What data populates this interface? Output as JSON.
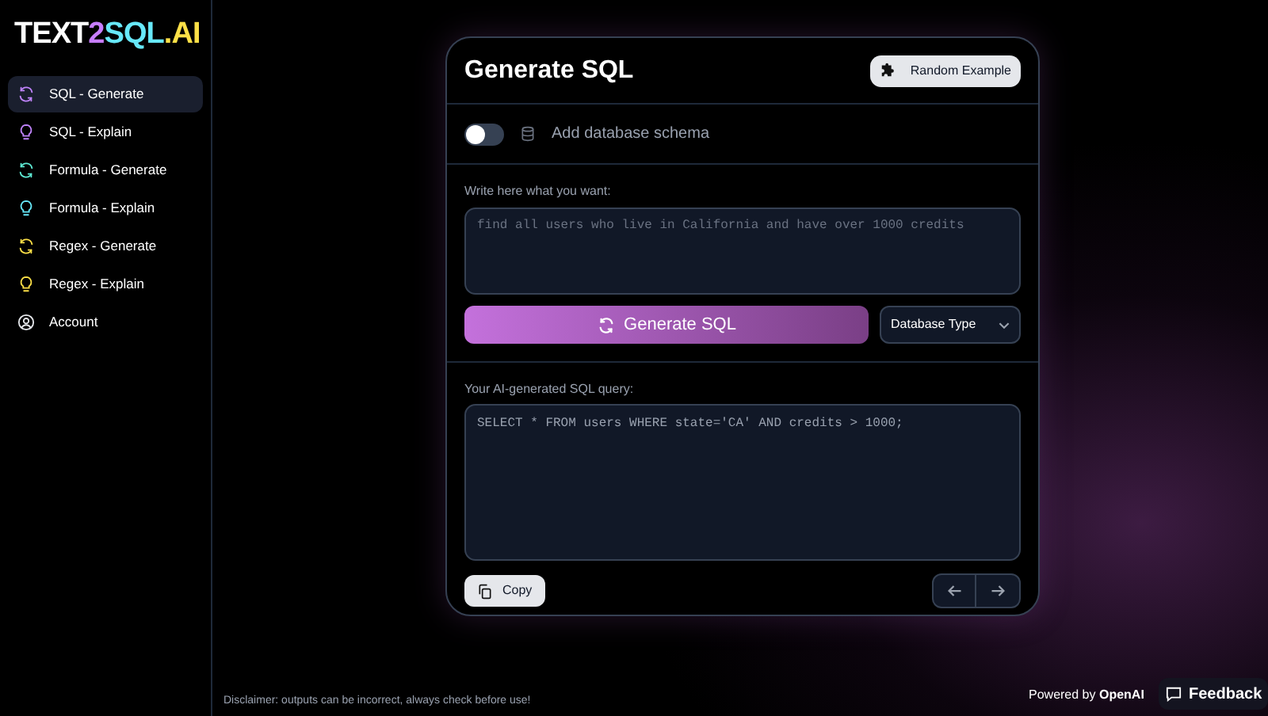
{
  "logo": [
    {
      "text": "TEXT",
      "color": "#ffffff"
    },
    {
      "text": "2",
      "color": "#c77dff"
    },
    {
      "text": "SQL",
      "color": "#67e8f9"
    },
    {
      "text": ".AI",
      "color": "#fde047"
    }
  ],
  "sidebar": {
    "items": [
      {
        "label": "SQL - Generate",
        "kind": "generate",
        "color": "#c084fc",
        "selected": true
      },
      {
        "label": "SQL - Explain",
        "kind": "explain",
        "color": "#c084fc",
        "selected": false
      },
      {
        "label": "Formula - Generate",
        "kind": "generate",
        "color": "#5eead4",
        "selected": false
      },
      {
        "label": "Formula - Explain",
        "kind": "explain",
        "color": "#67e8f9",
        "selected": false
      },
      {
        "label": "Regex - Generate",
        "kind": "generate",
        "color": "#fde047",
        "selected": false
      },
      {
        "label": "Regex - Explain",
        "kind": "explain",
        "color": "#fde047",
        "selected": false
      },
      {
        "label": "Account",
        "kind": "account",
        "color": "#e5e7eb",
        "selected": false
      }
    ]
  },
  "card": {
    "title": "Generate SQL",
    "random_button": "Random Example",
    "schema_toggle": {
      "label": "Add database schema",
      "on": false
    },
    "prompt": {
      "label": "Write here what you want:",
      "placeholder": "find all users who live in California and have over 1000 credits"
    },
    "generate_button": "Generate SQL",
    "database_select": "Database Type",
    "result": {
      "label": "Your AI-generated SQL query:",
      "value": "SELECT * FROM users WHERE state='CA' AND credits > 1000;"
    },
    "copy_button": "Copy"
  },
  "footer": {
    "disclaimer": "Disclaimer: outputs can be incorrect, always check before use!",
    "powered": "Powered by **OpenAI**",
    "feedback": "Feedback"
  }
}
